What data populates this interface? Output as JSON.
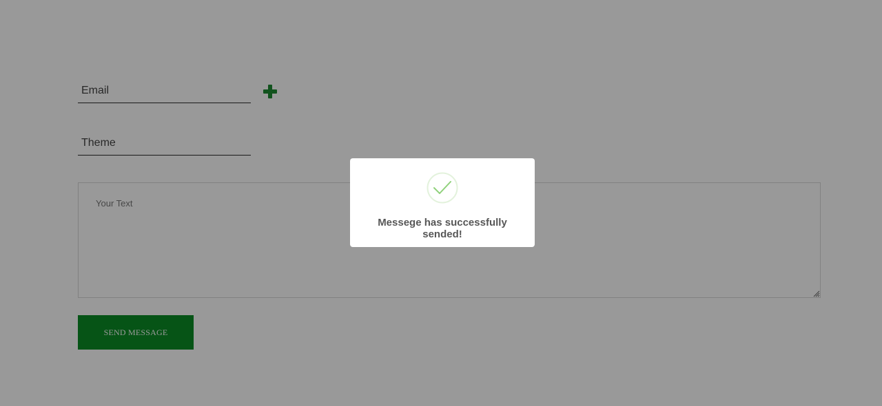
{
  "form": {
    "email_placeholder": "Email",
    "theme_placeholder": "Theme",
    "text_placeholder": "Your Text",
    "send_label": "SEND MESSAGE"
  },
  "icons": {
    "add": "plus-icon",
    "success": "check-circle-icon",
    "resize": "resize-grip-icon"
  },
  "modal": {
    "message": "Messege has successfully sended!"
  },
  "colors": {
    "accent": "#0a8c25",
    "overlay": "rgba(0,0,0,0.4)",
    "success_check": "#8fd17a"
  }
}
